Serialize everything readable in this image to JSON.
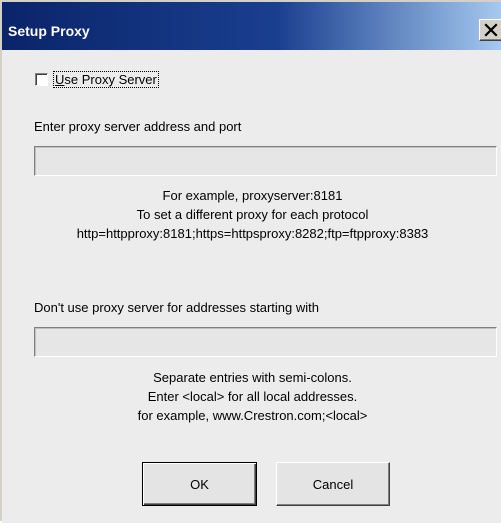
{
  "window": {
    "title": "Setup Proxy",
    "close_icon": "close-icon"
  },
  "use_proxy": {
    "label_prefix": "",
    "label_underlined": "U",
    "label_rest": "se Proxy Server",
    "checked": false
  },
  "proxy_address": {
    "label": "Enter proxy server address and port",
    "value": "",
    "placeholder": "",
    "help": [
      "For example,  proxyserver:8181",
      "To set a different proxy for each protocol",
      "http=httpproxy:8181;https=httpsproxy:8282;ftp=ftpproxy:8383"
    ]
  },
  "bypass": {
    "label": "Don't use proxy server for addresses starting with",
    "value": "",
    "placeholder": "",
    "help": [
      "Separate entries with semi-colons.",
      "Enter <local> for all local addresses.",
      "for example, www.Crestron.com;<local>"
    ]
  },
  "buttons": {
    "ok": "OK",
    "cancel": "Cancel"
  },
  "colors": {
    "titlebar_start": "#0a246a",
    "titlebar_end": "#a6caf0",
    "dialog_background": "#ececec"
  }
}
